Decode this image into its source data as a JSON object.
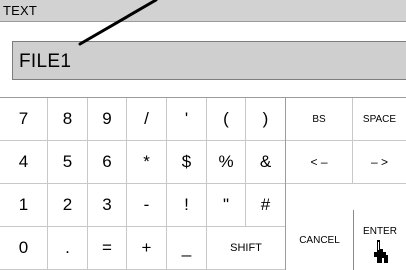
{
  "window": {
    "title": "TEXT"
  },
  "input": {
    "value": "FILE1"
  },
  "keypad": {
    "rows": [
      [
        "7",
        "8",
        "9",
        "/",
        "'",
        "(",
        ")"
      ],
      [
        "4",
        "5",
        "6",
        "*",
        "$",
        "%",
        "&"
      ],
      [
        "1",
        "2",
        "3",
        "-",
        "!",
        "\"",
        "#"
      ],
      [
        "0",
        ".",
        "=",
        "+",
        "_"
      ]
    ],
    "shift": "SHIFT"
  },
  "side_keys": {
    "bs": "BS",
    "space": "SPACE",
    "cursor_left": "< –",
    "cursor_right": "– >",
    "cancel": "CANCEL",
    "enter": "ENTER"
  },
  "icons": {
    "enter": "hand-pointer-icon",
    "pointer": "annotation-line"
  }
}
